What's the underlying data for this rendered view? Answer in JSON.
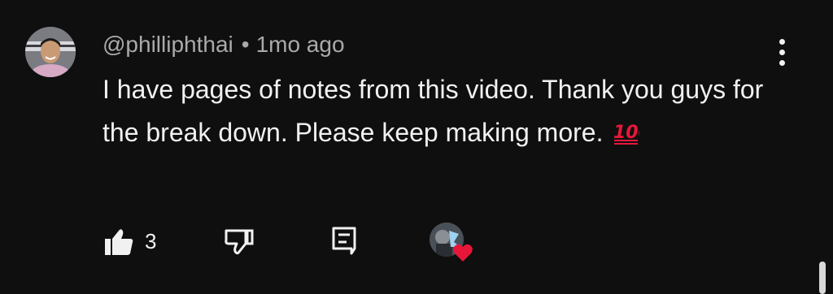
{
  "comment": {
    "author_handle": "@philliphthai",
    "separator": "•",
    "timestamp": "1mo ago",
    "text": "I have pages of notes from this video. Thank you guys for the break down. Please keep making more.",
    "emoji": "💯",
    "like_count": "3"
  },
  "icons": {
    "avatar": "user-avatar",
    "more": "vertical-ellipsis-icon",
    "like": "thumbs-up-filled-icon",
    "dislike": "thumbs-down-outline-icon",
    "reply": "reply-comment-icon",
    "creator_heart": "creator-heart-icon"
  },
  "colors": {
    "background": "#0f0f0f",
    "primary_text": "#f1f1f1",
    "secondary_text": "#aaaaaa",
    "heart": "#e8173a"
  }
}
